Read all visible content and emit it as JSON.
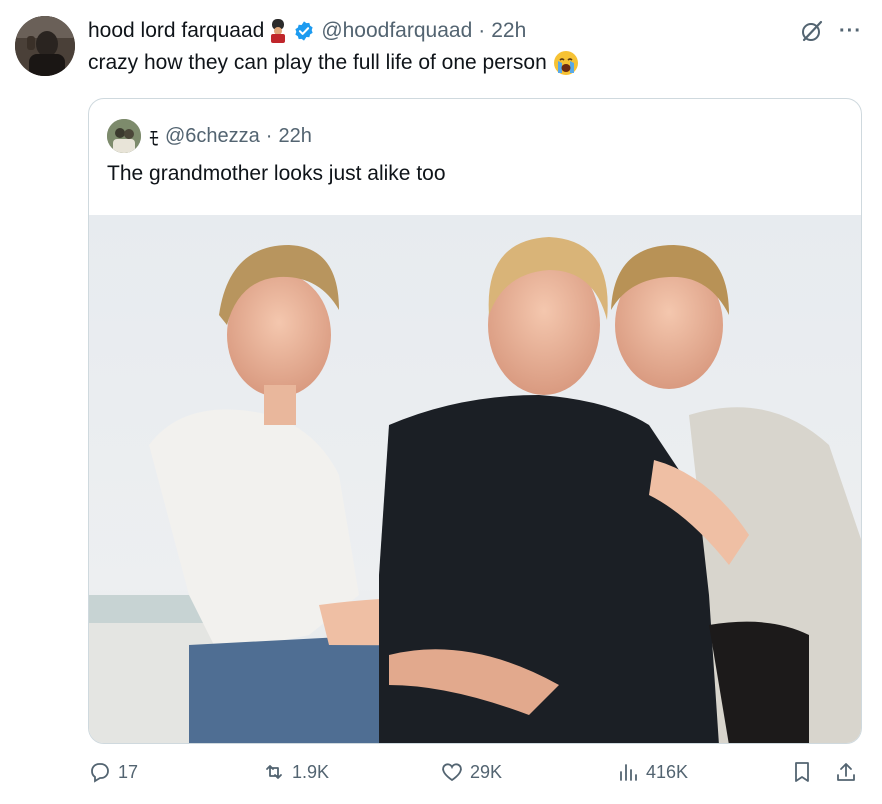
{
  "author": {
    "display_name": "hood lord farquaad",
    "handle": "@hoodfarquaad",
    "time": "22h",
    "separator": "·",
    "verified": true,
    "avatar_icon": "avatar-photo",
    "name_emoji": "guard-emoji"
  },
  "tweet": {
    "text": "crazy how they can play the full life of one person",
    "emoji": "crying-face-emoji"
  },
  "header_icons": {
    "grok": "grok-icon",
    "more": "···"
  },
  "quote": {
    "glyph": "ﾓ",
    "handle": "@6chezza",
    "separator": "·",
    "time": "22h",
    "text": "The grandmother looks just alike too",
    "photo": "photo-three-women-beach"
  },
  "actions": {
    "replies": "17",
    "reposts": "1.9K",
    "likes": "29K",
    "views": "416K"
  },
  "colors": {
    "text": "#0f1419",
    "secondary": "#536471",
    "verified": "#1d9bf0",
    "border": "#cfd9de"
  }
}
